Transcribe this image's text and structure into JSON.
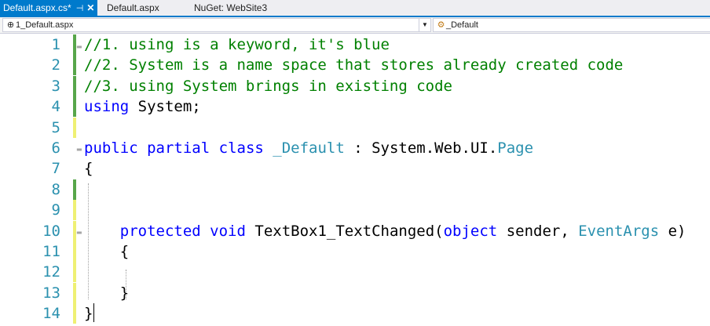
{
  "tabs": [
    {
      "label": "Default.aspx.cs*",
      "active": true,
      "pin_icon": "pin-icon",
      "close_icon": "close-icon"
    },
    {
      "label": "Default.aspx",
      "active": false
    },
    {
      "label": "NuGet: WebSite3",
      "active": false
    }
  ],
  "navbar": {
    "project_dropdown": {
      "icon": "globe-icon",
      "label": "1_Default.aspx"
    },
    "member_dropdown": {
      "icon": "class-icon",
      "label": "_Default"
    }
  },
  "editor": {
    "lines": [
      {
        "num": "1",
        "change": "saved",
        "tokens": [
          {
            "t": "//1. using is a keyword, it's blue",
            "c": "cm"
          }
        ]
      },
      {
        "num": "2",
        "change": "saved",
        "tokens": [
          {
            "t": "//2. System is a name space that stores already created code",
            "c": "cm"
          }
        ]
      },
      {
        "num": "3",
        "change": "saved",
        "tokens": [
          {
            "t": "//3. using System brings in existing code",
            "c": "cm"
          }
        ]
      },
      {
        "num": "4",
        "change": "saved",
        "tokens": [
          {
            "t": "using",
            "c": "kw"
          },
          {
            "t": " System;",
            "c": "pl"
          }
        ]
      },
      {
        "num": "5",
        "change": "unsaved",
        "tokens": []
      },
      {
        "num": "6",
        "change": "none",
        "tokens": [
          {
            "t": "public",
            "c": "kw"
          },
          {
            "t": " ",
            "c": "pl"
          },
          {
            "t": "partial",
            "c": "kw"
          },
          {
            "t": " ",
            "c": "pl"
          },
          {
            "t": "class",
            "c": "kw"
          },
          {
            "t": " ",
            "c": "pl"
          },
          {
            "t": "_Default",
            "c": "ty"
          },
          {
            "t": " : System.Web.UI.",
            "c": "pl"
          },
          {
            "t": "Page",
            "c": "ty"
          }
        ]
      },
      {
        "num": "7",
        "change": "none",
        "tokens": [
          {
            "t": "{",
            "c": "pl"
          }
        ]
      },
      {
        "num": "8",
        "change": "saved",
        "tokens": []
      },
      {
        "num": "9",
        "change": "unsaved",
        "tokens": []
      },
      {
        "num": "10",
        "change": "unsaved",
        "tokens": [
          {
            "t": "    ",
            "c": "pl"
          },
          {
            "t": "protected",
            "c": "kw"
          },
          {
            "t": " ",
            "c": "pl"
          },
          {
            "t": "void",
            "c": "kw"
          },
          {
            "t": " TextBox1_TextChanged(",
            "c": "pl"
          },
          {
            "t": "object",
            "c": "kw"
          },
          {
            "t": " sender, ",
            "c": "pl"
          },
          {
            "t": "EventArgs",
            "c": "ty"
          },
          {
            "t": " e)",
            "c": "pl"
          }
        ]
      },
      {
        "num": "11",
        "change": "unsaved",
        "tokens": [
          {
            "t": "    {",
            "c": "pl"
          }
        ]
      },
      {
        "num": "12",
        "change": "unsaved",
        "tokens": []
      },
      {
        "num": "13",
        "change": "unsaved",
        "tokens": [
          {
            "t": "    }",
            "c": "pl"
          }
        ]
      },
      {
        "num": "14",
        "change": "unsaved",
        "tokens": [
          {
            "t": "}",
            "c": "pl"
          }
        ]
      }
    ]
  },
  "colors": {
    "accent": "#007ACC",
    "comment": "#008000",
    "keyword": "#0000FF",
    "type": "#2B91AF",
    "line_number": "#2B91AF",
    "saved_change": "#57A64A",
    "unsaved_change": "#EFF073"
  }
}
